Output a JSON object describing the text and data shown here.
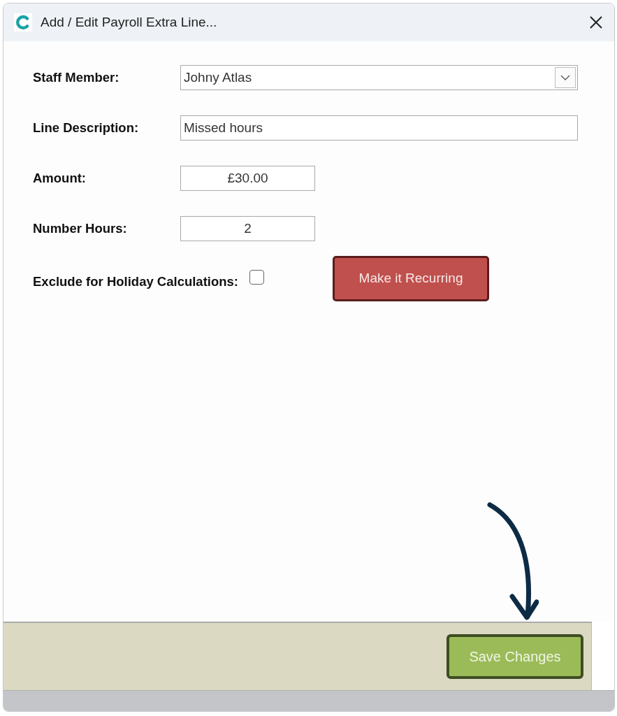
{
  "window": {
    "title": "Add / Edit Payroll Extra Line..."
  },
  "form": {
    "fields": [
      {
        "kind": "select",
        "label": "Staff Member:",
        "value": "Johny Atlas"
      },
      {
        "kind": "text",
        "label": "Line Description:",
        "value": "Missed hours"
      },
      {
        "kind": "number",
        "label": "Amount:",
        "value": "£30.00"
      },
      {
        "kind": "number",
        "label": "Number Hours:",
        "value": "2"
      },
      {
        "kind": "checkbox",
        "label": "Exclude for Holiday Calculations:",
        "checked": false
      }
    ],
    "recurring_button": {
      "label": "Make it Recurring"
    }
  },
  "footer": {
    "buttons": [
      {
        "label": "Save Changes"
      }
    ]
  }
}
